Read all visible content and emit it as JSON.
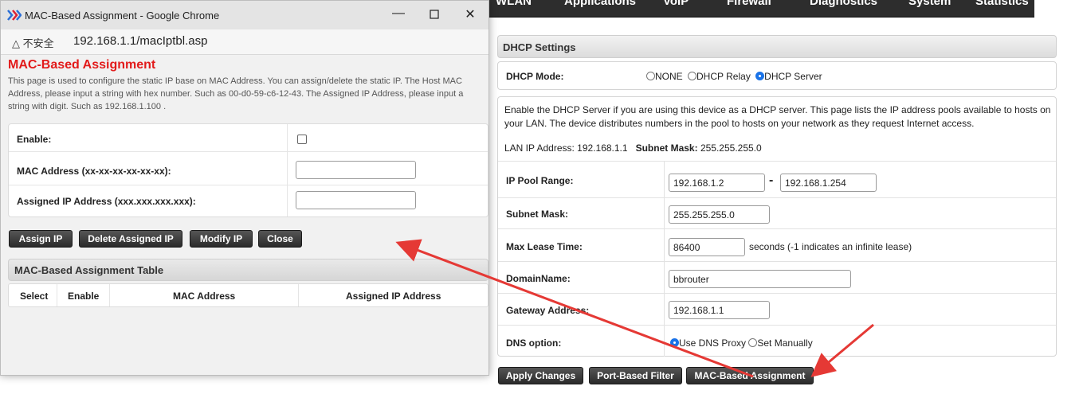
{
  "background_page": {
    "nav": [
      "WLAN",
      "Applications",
      "VoIP",
      "Firewall",
      "Diagnostics",
      "System",
      "Statistics"
    ],
    "dhcp_header": "DHCP Settings",
    "dhcp_mode_label": "DHCP Mode:",
    "mode_options": [
      {
        "label": "NONE",
        "selected": false
      },
      {
        "label": "DHCP Relay",
        "selected": false
      },
      {
        "label": "DHCP Server",
        "selected": true
      }
    ],
    "description": "Enable the DHCP Server if you are using this device as a DHCP server. This page lists the IP address pools available to hosts on your LAN. The device distributes numbers in the pool to hosts on your network as they request Internet access.",
    "lan_ip_label": "LAN IP Address:",
    "lan_ip": "192.168.1.1",
    "subnet_mask_label": "Subnet Mask:",
    "subnet_mask_value": "255.255.255.0",
    "fields": {
      "ip_pool_label": "IP Pool Range:",
      "ip_pool_start": "192.168.1.2",
      "ip_pool_dash": "-",
      "ip_pool_end": "192.168.1.254",
      "subnet_label": "Subnet Mask:",
      "subnet_value": "255.255.255.0",
      "lease_label": "Max Lease Time:",
      "lease_value": "86400",
      "lease_note": "seconds (-1 indicates an infinite lease)",
      "domain_label": "DomainName:",
      "domain_value": "bbrouter",
      "gateway_label": "Gateway Address:",
      "gateway_value": "192.168.1.1",
      "dns_label": "DNS option:",
      "dns_proxy": "Use DNS Proxy",
      "dns_manual": "Set Manually"
    },
    "buttons": {
      "apply": "Apply Changes",
      "port_filter": "Port-Based Filter",
      "mac_assignment": "MAC-Based Assignment"
    }
  },
  "popup": {
    "window_title": "MAC-Based Assignment - Google Chrome",
    "insecure_label": "不安全",
    "url": "192.168.1.1/macIptbl.asp",
    "page_title": "MAC-Based Assignment",
    "description": "This page is used to configure the static IP base on MAC Address. You can assign/delete the static IP. The Host MAC Address, please input a string with hex number. Such as 00-d0-59-c6-12-43. The Assigned IP Address, please input a string with digit. Such as 192.168.1.100 .",
    "form": {
      "enable_label": "Enable:",
      "mac_label": "MAC Address (xx-xx-xx-xx-xx-xx):",
      "mac_value": "",
      "ip_label": "Assigned IP Address (xxx.xxx.xxx.xxx):",
      "ip_value": ""
    },
    "buttons": {
      "assign": "Assign IP",
      "delete": "Delete Assigned IP",
      "modify": "Modify IP",
      "close": "Close"
    },
    "table_title": "MAC-Based Assignment Table",
    "table_columns": [
      "Select",
      "Enable",
      "MAC Address",
      "Assigned IP Address"
    ]
  },
  "colors": {
    "title_red": "#e21b1b",
    "radio_blue": "#1a73e8",
    "arrow_red": "#e53935",
    "nav_bg": "#2d2d2d"
  }
}
